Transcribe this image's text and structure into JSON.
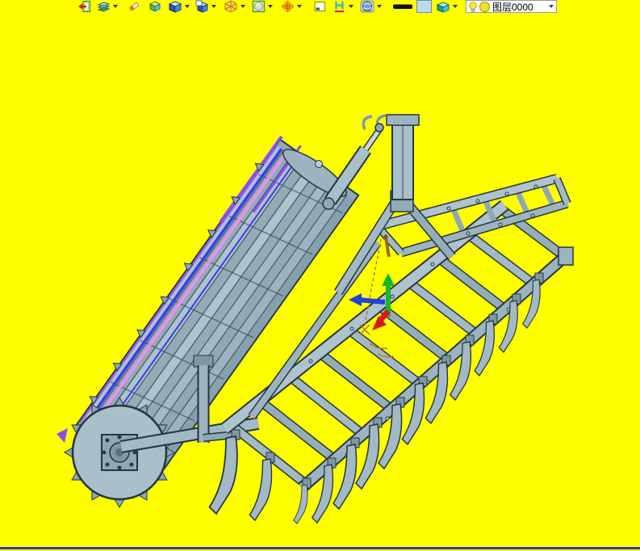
{
  "app": {
    "background_color": "#ffff00",
    "bottom_edge_color": "#2238cc"
  },
  "toolbar": {
    "icons": [
      {
        "name": "exit-icon",
        "dropdown": false
      },
      {
        "name": "layers-icon",
        "dropdown": true
      },
      {
        "name": "eraser-icon",
        "dropdown": false
      },
      {
        "name": "iso-box-icon",
        "dropdown": false
      },
      {
        "name": "shaded-box-icon",
        "dropdown": true
      },
      {
        "name": "box-window-icon",
        "dropdown": true
      },
      {
        "name": "wireframe-sphere-icon",
        "dropdown": true
      },
      {
        "name": "render-sphere-icon",
        "dropdown": true
      },
      {
        "name": "compass-icon",
        "dropdown": true
      },
      {
        "name": "frame-square-icon",
        "dropdown": false
      },
      {
        "name": "measure-icon",
        "dropdown": true
      },
      {
        "name": "globe-icon",
        "dropdown": true
      },
      {
        "name": "line-width-icon",
        "dropdown": false
      },
      {
        "name": "color-swatch-icon",
        "dropdown": false
      },
      {
        "name": "teal-box-icon",
        "dropdown": true
      }
    ],
    "layer_selector": {
      "value": "图层0000",
      "icons": [
        "bulb-icon",
        "layer-color-icon"
      ],
      "dropdown": true
    }
  },
  "viewport": {
    "content": "3d-cad-model-subsoiler-cultivator-with-cage-roller",
    "colors": {
      "steel_light": "#a9bfc9",
      "steel_mid": "#93abb7",
      "steel_dark": "#7e98a4",
      "outline": "#243640",
      "highlight_blue": "#3a3aee",
      "highlight_violet": "#8a4df0",
      "highlight_pink": "#ef8fef",
      "triad_green": "#18b828",
      "triad_blue": "#2040e0",
      "triad_red": "#d81818",
      "sketch_orange": "#b5781e"
    }
  }
}
